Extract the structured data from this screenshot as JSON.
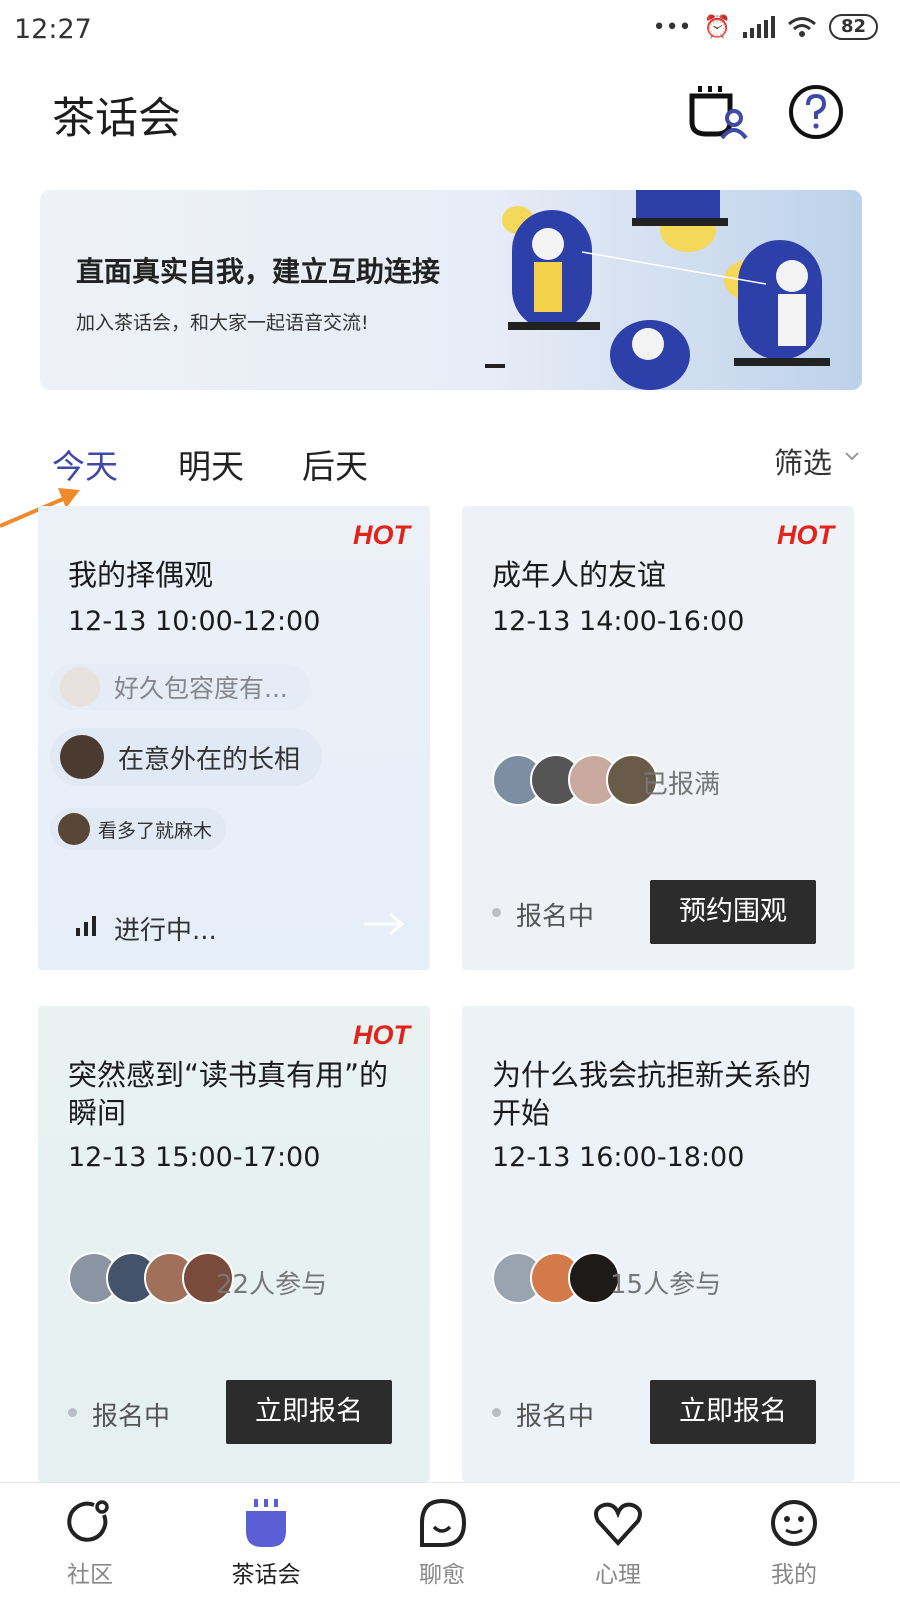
{
  "status_bar": {
    "time": "12:27",
    "battery": "82"
  },
  "header": {
    "title": "茶话会",
    "icons": [
      "cup-user-icon",
      "help-icon"
    ]
  },
  "banner": {
    "title": "直面真实自我，建立互助连接",
    "subtitle": "加入茶话会，和大家一起语音交流!"
  },
  "date_tabs": [
    {
      "label": "今天",
      "active": true
    },
    {
      "label": "明天",
      "active": false
    },
    {
      "label": "后天",
      "active": false
    }
  ],
  "filter": {
    "label": "筛选",
    "icon": "chevron-down-icon"
  },
  "cards": [
    {
      "badge": "HOT",
      "title": "我的择偶观",
      "time": "12-13 10:00-12:00",
      "comments": [
        "好久包容度有...",
        "在意外在的长相",
        "看多了就麻木"
      ],
      "status": "进行中..."
    },
    {
      "badge": "HOT",
      "title": "成年人的友谊",
      "time": "12-13 14:00-16:00",
      "participants": "已报满",
      "status": "报名中",
      "button": "预约围观"
    },
    {
      "badge": "HOT",
      "title": "突然感到“读书真有用”的瞬间",
      "time": "12-13 15:00-17:00",
      "participants": "22人参与",
      "status": "报名中",
      "button": "立即报名"
    },
    {
      "title": "为什么我会抗拒新关系的开始",
      "time": "12-13 16:00-18:00",
      "participants": "15人参与",
      "status": "报名中",
      "button": "立即报名"
    }
  ],
  "bottom_nav": [
    {
      "label": "社区",
      "icon": "community-icon",
      "active": false
    },
    {
      "label": "茶话会",
      "icon": "tea-party-icon",
      "active": true
    },
    {
      "label": "聊愈",
      "icon": "chat-heal-icon",
      "active": false
    },
    {
      "label": "心理",
      "icon": "heart-icon",
      "active": false
    },
    {
      "label": "我的",
      "icon": "profile-face-icon",
      "active": false
    }
  ],
  "colors": {
    "accent": "#3f4aa8",
    "hot": "#e2231a",
    "button": "#2c2c2c",
    "nav_active": "#5b5fd6"
  }
}
